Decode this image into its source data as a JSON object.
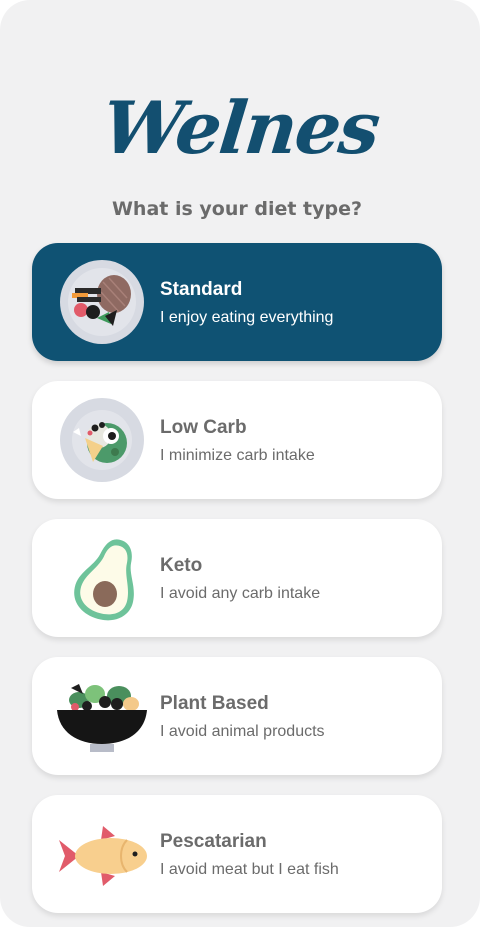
{
  "app": {
    "logo_text": "Welnes"
  },
  "question": "What is your diet type?",
  "options": [
    {
      "title": "Standard",
      "subtitle": "I enjoy eating everything",
      "icon": "food-plate-icon",
      "selected": true
    },
    {
      "title": "Low Carb",
      "subtitle": "I minimize carb intake",
      "icon": "salad-plate-icon",
      "selected": false
    },
    {
      "title": "Keto",
      "subtitle": "I avoid any carb intake",
      "icon": "avocado-icon",
      "selected": false
    },
    {
      "title": "Plant Based",
      "subtitle": "I avoid animal products",
      "icon": "salad-bowl-icon",
      "selected": false
    },
    {
      "title": "Pescatarian",
      "subtitle": "I avoid meat but I eat fish",
      "icon": "fish-icon",
      "selected": false
    }
  ],
  "colors": {
    "brand": "#134f70",
    "selected_card": "#0f5273",
    "background": "#f1f1f2",
    "text_gray": "#6b6b6b"
  }
}
